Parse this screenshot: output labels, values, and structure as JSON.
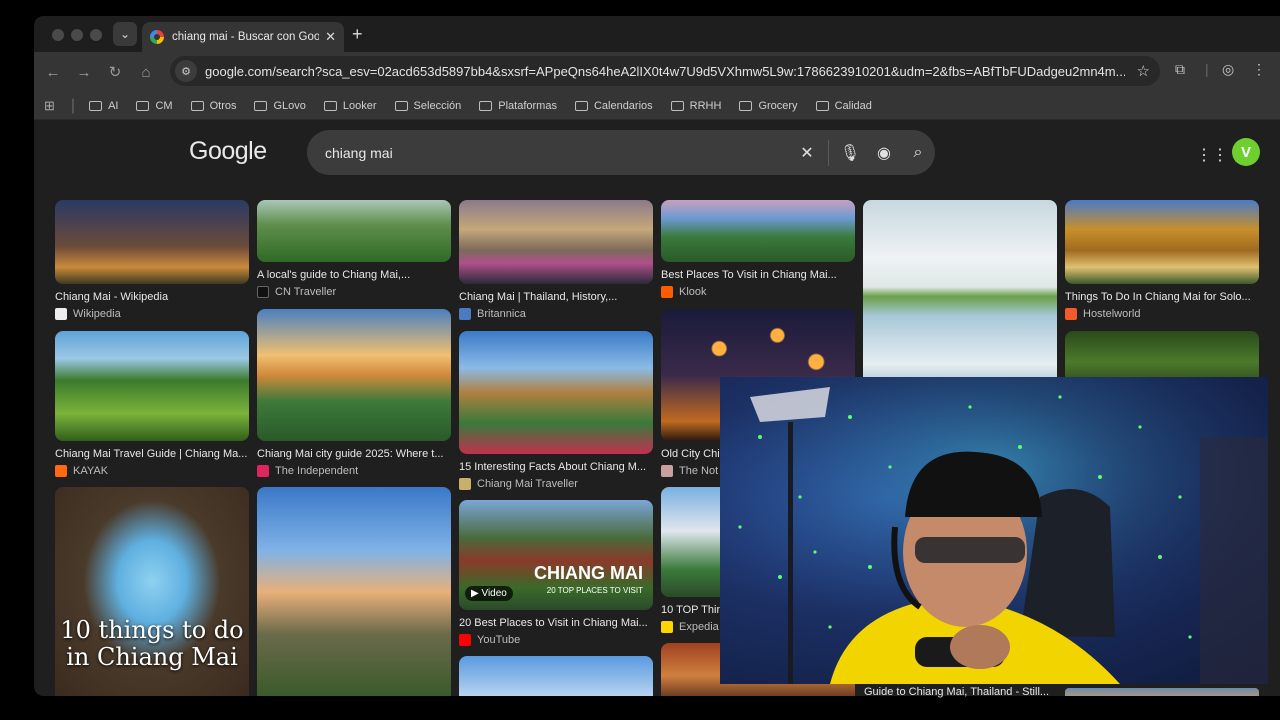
{
  "browser": {
    "tab_title": "chiang mai - Buscar con Goo",
    "url": "google.com/search?sca_esv=02acd653d5897bb4&sxsrf=APpeQns64heA2lIX0t4w7U9d5VXhmw5L9w:1786623910201&udm=2&fbs=ABfTbFUDadgeu2mn4m...",
    "bookmarks": [
      "AI",
      "CM",
      "Otros",
      "GLovo",
      "Looker",
      "Selección",
      "Plataformas",
      "Calendarios",
      "RRHH",
      "Grocery",
      "Calidad"
    ]
  },
  "google": {
    "logo": "Google",
    "query": "chiang mai",
    "avatar": "V"
  },
  "results": {
    "col1": [
      {
        "caption": "Chiang Mai - Wikipedia",
        "source": "Wikipedia"
      },
      {
        "caption": "Chiang Mai Travel Guide | Chiang Ma...",
        "source": "KAYAK"
      },
      {
        "poster": "10 things to do in Chiang Mai"
      }
    ],
    "col2": [
      {
        "caption": "A local's guide to Chiang Mai,...",
        "source": "CN Traveller"
      },
      {
        "caption": "Chiang Mai city guide 2025: Where t...",
        "source": "The Independent"
      }
    ],
    "col3": [
      {
        "caption": "Chiang Mai | Thailand, History,...",
        "source": "Britannica"
      },
      {
        "caption": "15 Interesting Facts About Chiang M...",
        "source": "Chiang Mai Traveller"
      },
      {
        "caption": "20 Best Places to Visit in Chiang Mai...",
        "source": "YouTube",
        "badge": "Video",
        "overlay_title": "CHIANG MAI",
        "overlay_sub": "TOP PLACES TO VISIT",
        "overlay_num": "20"
      }
    ],
    "col4": [
      {
        "caption": "Best Places To Visit in Chiang Mai...",
        "source": "Klook"
      },
      {
        "caption": "Old City Chi",
        "source": "The Not"
      },
      {
        "caption": "10 TOP Thin",
        "source": "Expedia"
      }
    ],
    "col6": [
      {
        "caption": "Things To Do In Chiang Mai for Solo...",
        "source": "Hostelworld"
      }
    ],
    "partial_caption": "Guide to Chiang Mai, Thailand - Still..."
  },
  "colors": {
    "page_bg": "#1f1f1f",
    "searchbox_bg": "#3c3c3c",
    "avatar": "#6fcf2f"
  }
}
